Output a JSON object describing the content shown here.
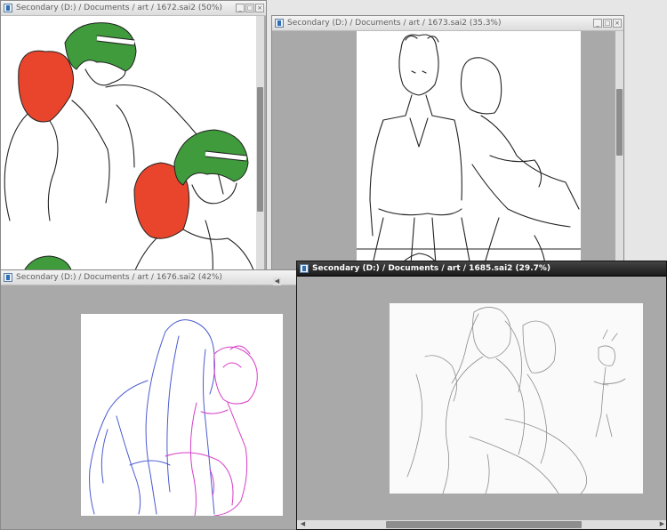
{
  "windows": [
    {
      "title": "Secondary (D:) / Documents / art / 1672.sai2 (50%)"
    },
    {
      "title": "Secondary (D:) / Documents / art / 1673.sai2 (35.3%)"
    },
    {
      "title": "Secondary (D:) / Documents / art / 1676.sai2 (42%)"
    },
    {
      "title": "Secondary (D:) / Documents / art / 1685.sai2 (29.7%)"
    }
  ],
  "colors": {
    "workspace": "#a9a9a9",
    "hair_red": "#e8452c",
    "hair_green": "#3f9b3b",
    "sketch_blue": "#4a5ad0",
    "sketch_magenta": "#d63cc8",
    "active_titlebar": "#1a1a1a"
  },
  "icons": {
    "window": "canvas-window-icon",
    "minimize": "minimize-icon",
    "maximize": "maximize-icon",
    "close": "close-icon"
  }
}
